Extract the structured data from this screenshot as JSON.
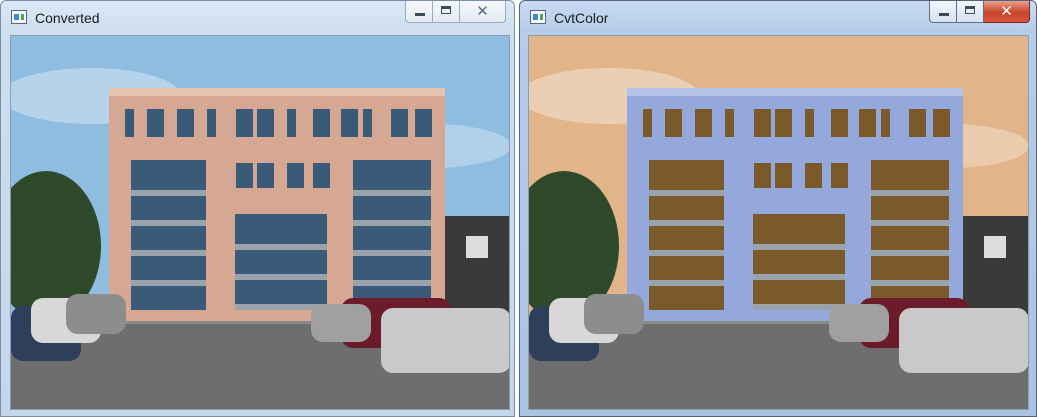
{
  "windows": [
    {
      "title": "Converted",
      "active": false,
      "buttons": {
        "minimize": "minimize",
        "maximize": "maximize",
        "close": "close"
      },
      "image_colors": {
        "sky": "#8ebde0",
        "facade": "#d6a894",
        "glass": "#3a5a78",
        "trim": "#e7c3b2"
      }
    },
    {
      "title": "CvtColor",
      "active": true,
      "buttons": {
        "minimize": "minimize",
        "maximize": "maximize",
        "close": "close"
      },
      "image_colors": {
        "sky": "#e1b589",
        "facade": "#94a8dc",
        "glass": "#7a5a2a",
        "trim": "#b2c3e7"
      }
    }
  ],
  "close_glyph": "✕"
}
